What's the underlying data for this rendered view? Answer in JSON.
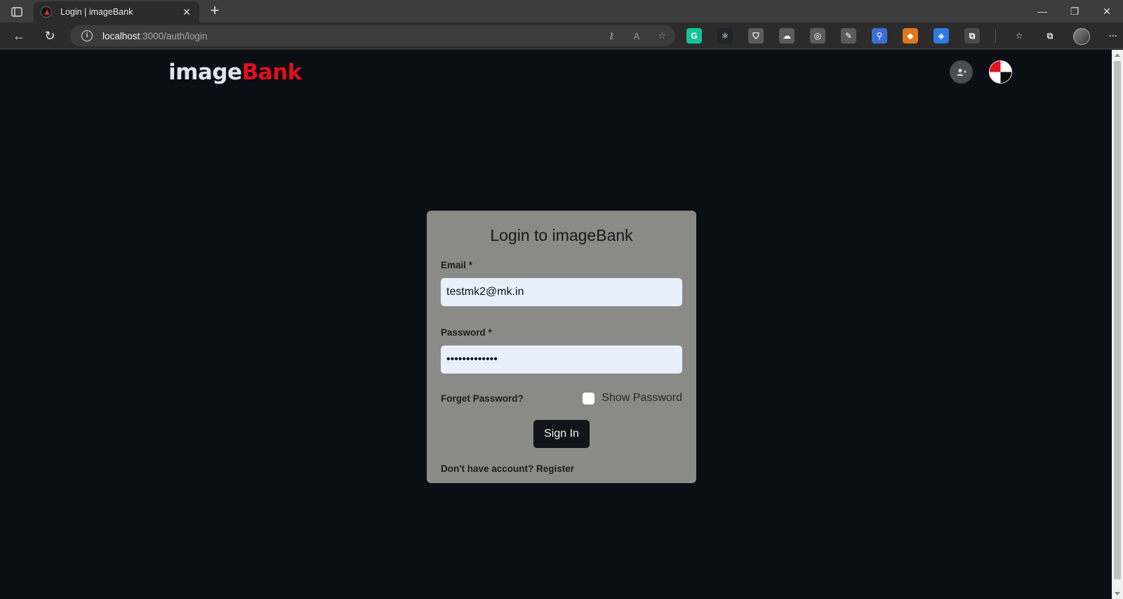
{
  "browser": {
    "tab_title": "Login | imageBank",
    "url_host": "localhost",
    "url_path": ":3000/auth/login",
    "tab_close_glyph": "✕",
    "newtab_glyph": "+",
    "minimize_glyph": "—",
    "restore_glyph": "❐",
    "close_glyph": "✕",
    "back_glyph": "←",
    "reload_glyph": "↻",
    "more_glyph": "···",
    "extensions": [
      {
        "name": "grammarly-icon",
        "color": "#15c39a",
        "glyph": "G"
      },
      {
        "name": "react-devtools-icon",
        "color": "#20232a",
        "glyph": "⚛"
      },
      {
        "name": "shield-icon",
        "color": "#5b5b5b",
        "glyph": "⛉"
      },
      {
        "name": "cloud-icon",
        "color": "#5b5b5b",
        "glyph": "☁"
      },
      {
        "name": "target-icon",
        "color": "#5b5b5b",
        "glyph": "◎"
      },
      {
        "name": "pen-icon",
        "color": "#5b5b5b",
        "glyph": "✎"
      },
      {
        "name": "magnifier-icon",
        "color": "#3b6fd6",
        "glyph": "⚲"
      },
      {
        "name": "metamask-icon",
        "color": "#e2761b",
        "glyph": "◆"
      },
      {
        "name": "tag-icon",
        "color": "#2f7be0",
        "glyph": "◈"
      },
      {
        "name": "puzzle-icon",
        "color": "#4a4a4a",
        "glyph": "⧉"
      }
    ]
  },
  "header": {
    "logo_part1": "image",
    "logo_part2": "Bank",
    "accent_color": "#e0101c"
  },
  "login": {
    "title": "Login to imageBank",
    "email_label": "Email *",
    "email_value": "testmk2@mk.in",
    "password_label": "Password *",
    "password_value": "•••••••••••••",
    "forget_label": "Forget Password?",
    "show_password_label": "Show Password",
    "show_password_checked": false,
    "signin_label": "Sign In",
    "register_text": "Don't have account? Register"
  }
}
